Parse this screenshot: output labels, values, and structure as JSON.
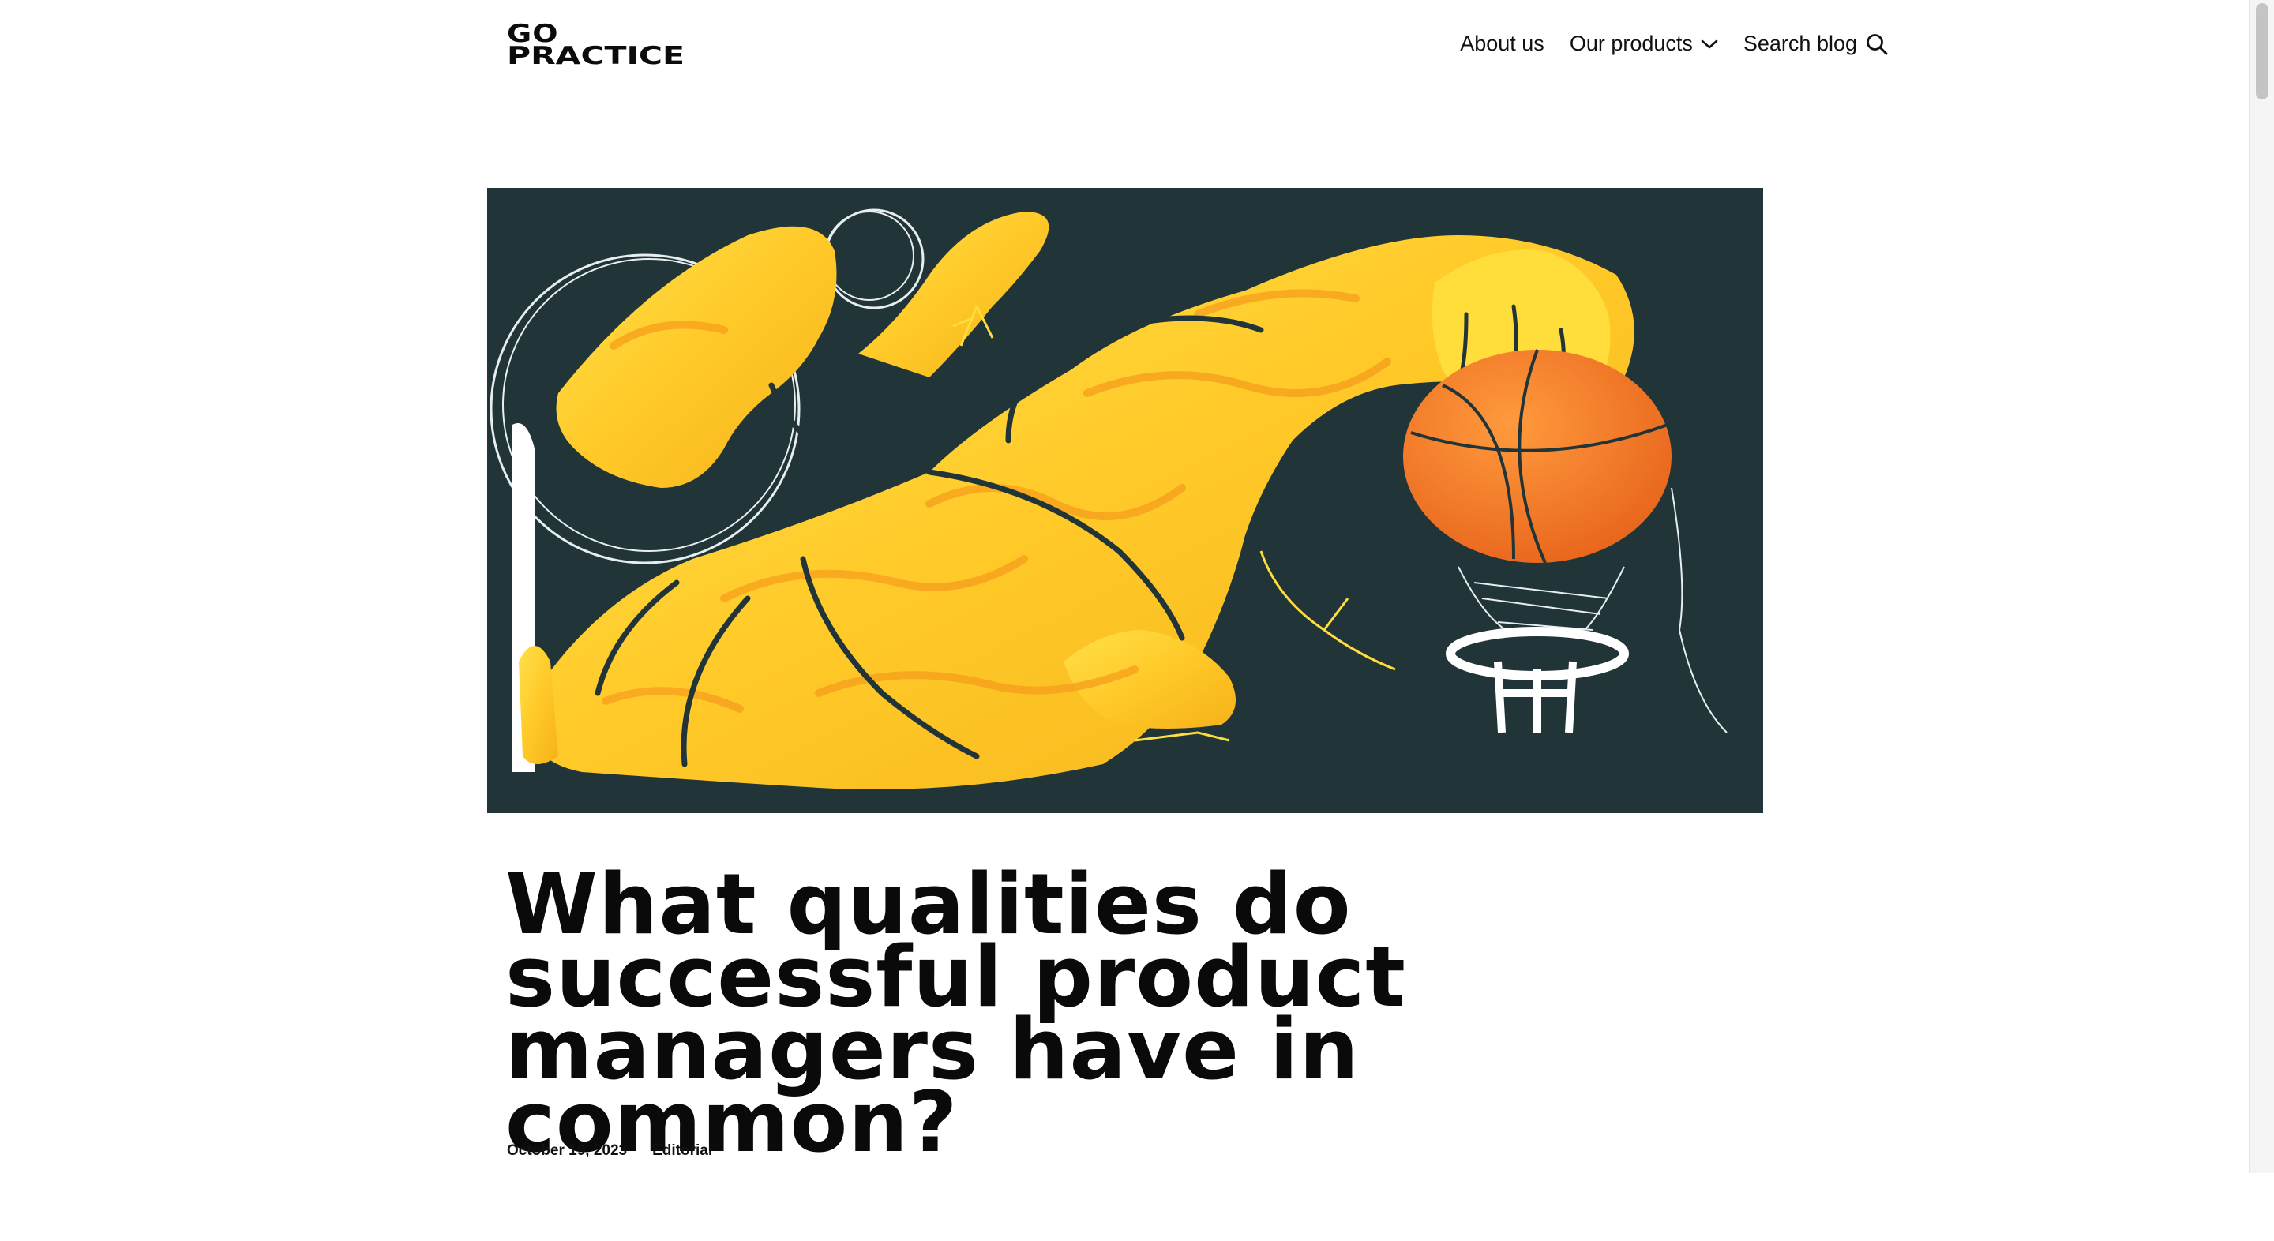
{
  "header": {
    "logo": {
      "line1": "GO",
      "line2": "PRACTICE"
    },
    "nav": [
      {
        "label": "About us"
      },
      {
        "label": "Our products",
        "icon": "chevron-down-icon"
      },
      {
        "label": "Search blog",
        "icon": "search-icon"
      }
    ]
  },
  "hero": {
    "icon": "basketball-illustration",
    "colors": {
      "background": "#213539",
      "figure": "#FFC928",
      "ball": "#F07A26"
    }
  },
  "article": {
    "title": "What qualities do successful product managers have in common?",
    "date": "October 19, 2023",
    "category": "Editorial"
  }
}
